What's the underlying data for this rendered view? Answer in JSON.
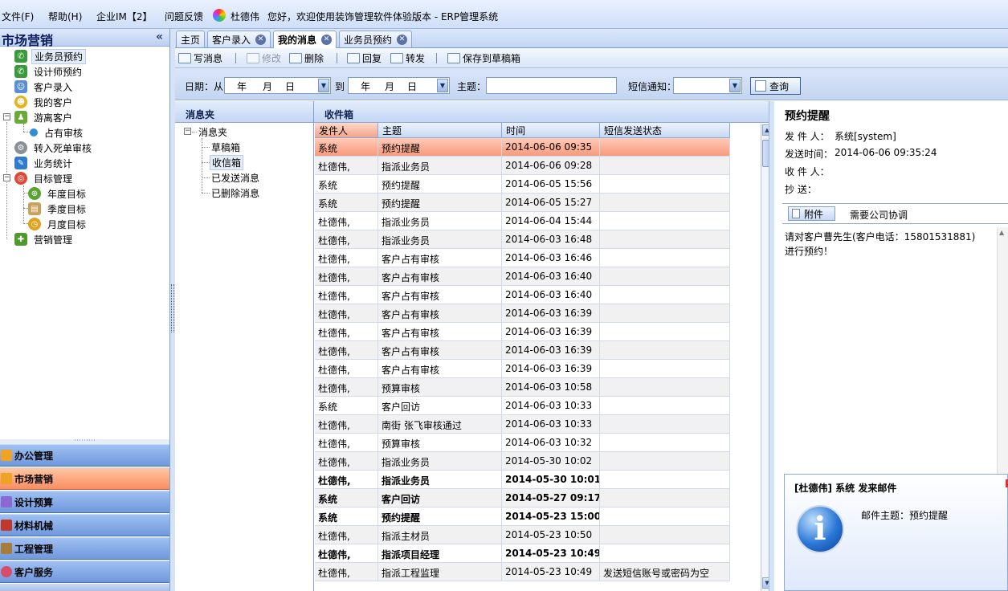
{
  "menubar": {
    "items": [
      "文件(F)",
      "帮助(H)",
      "企业IM【2】",
      "问题反馈"
    ],
    "user": "杜德伟",
    "greeting": "您好，欢迎使用装饰管理软件体验版本 - ERP管理系统"
  },
  "sidebar": {
    "title": "市场营销",
    "collapse": "«",
    "items": [
      {
        "label": "业务员预约"
      },
      {
        "label": "设计师预约"
      },
      {
        "label": "客户录入"
      },
      {
        "label": "我的客户"
      },
      {
        "label": "游离客户"
      },
      {
        "label": "占有审核"
      },
      {
        "label": "转入死单审核"
      },
      {
        "label": "业务统计"
      },
      {
        "label": "目标管理"
      },
      {
        "label": "年度目标"
      },
      {
        "label": "季度目标"
      },
      {
        "label": "月度目标"
      },
      {
        "label": "营销管理"
      }
    ],
    "nav": [
      "办公管理",
      "市场营销",
      "设计预算",
      "材料机械",
      "工程管理",
      "客户服务"
    ]
  },
  "tabs": [
    "主页",
    "客户录入",
    "我的消息",
    "业务员预约"
  ],
  "toolbar": {
    "write": "写消息",
    "edit": "修改",
    "delete": "删除",
    "reply": "回复",
    "forward": "转发",
    "save_draft": "保存到草稿箱"
  },
  "filter": {
    "date_label": "日期：从",
    "year": "年",
    "month": "月",
    "day": "日",
    "to": "到",
    "subject_label": "主题：",
    "subject_value": "",
    "sms_label": "短信通知：",
    "sms_value": "",
    "query": "查询"
  },
  "folders": {
    "title": "消息夹",
    "root": "消息夹",
    "items": [
      "草稿箱",
      "收信箱",
      "已发送消息",
      "已删除消息"
    ]
  },
  "inbox": {
    "title": "收件箱",
    "columns": [
      "发件人",
      "主题",
      "时间",
      "短信发送状态"
    ],
    "rows": [
      [
        "系统",
        "预约提醒",
        "2014-06-06 09:35",
        ""
      ],
      [
        "杜德伟,",
        "指派业务员",
        "2014-06-06 09:28",
        ""
      ],
      [
        "系统",
        "预约提醒",
        "2014-06-05 15:56",
        ""
      ],
      [
        "系统",
        "预约提醒",
        "2014-06-05 15:27",
        ""
      ],
      [
        "杜德伟,",
        "指派业务员",
        "2014-06-04 15:44",
        ""
      ],
      [
        "杜德伟,",
        "指派业务员",
        "2014-06-03 16:48",
        ""
      ],
      [
        "杜德伟,",
        "客户占有审核",
        "2014-06-03 16:46",
        ""
      ],
      [
        "杜德伟,",
        "客户占有审核",
        "2014-06-03 16:40",
        ""
      ],
      [
        "杜德伟,",
        "客户占有审核",
        "2014-06-03 16:40",
        ""
      ],
      [
        "杜德伟,",
        "客户占有审核",
        "2014-06-03 16:39",
        ""
      ],
      [
        "杜德伟,",
        "客户占有审核",
        "2014-06-03 16:39",
        ""
      ],
      [
        "杜德伟,",
        "客户占有审核",
        "2014-06-03 16:39",
        ""
      ],
      [
        "杜德伟,",
        "客户占有审核",
        "2014-06-03 16:39",
        ""
      ],
      [
        "杜德伟,",
        "预算审核",
        "2014-06-03 10:58",
        ""
      ],
      [
        "系统",
        "客户回访",
        "2014-06-03 10:33",
        ""
      ],
      [
        "杜德伟,",
        "南街 张飞审核通过",
        "2014-06-03 10:33",
        ""
      ],
      [
        "杜德伟,",
        "预算审核",
        "2014-06-03 10:32",
        ""
      ],
      [
        "杜德伟,",
        "指派业务员",
        "2014-05-30 10:02",
        ""
      ],
      [
        "杜德伟,",
        "指派业务员",
        "2014-05-30 10:01",
        ""
      ],
      [
        "系统",
        "客户回访",
        "2014-05-27 09:17",
        ""
      ],
      [
        "系统",
        "预约提醒",
        "2014-05-23 15:00",
        ""
      ],
      [
        "杜德伟,",
        "指派主材员",
        "2014-05-23 10:50",
        ""
      ],
      [
        "杜德伟,",
        "指派项目经理",
        "2014-05-23 10:49",
        ""
      ],
      [
        "杜德伟,",
        "指派工程监理",
        "2014-05-23 10:49",
        "发送短信账号或密码为空"
      ]
    ]
  },
  "preview": {
    "title": "预约提醒",
    "sender_label": "发 件 人：",
    "sender": "系统[system]",
    "time_label": "发送时间：",
    "time": "2014-06-06 09:35:24",
    "recipient_label": "收 件 人：",
    "cc_label": "抄    送：",
    "attach": "附件",
    "note": "需要公司协调",
    "body_line1": "请对客户曹先生(客户电话：15801531881)",
    "body_line2": "进行预约！"
  },
  "popup": {
    "title": "[杜德伟] 系统 发来邮件",
    "subject": "邮件主题：预约提醒",
    "icon_letter": "i"
  }
}
